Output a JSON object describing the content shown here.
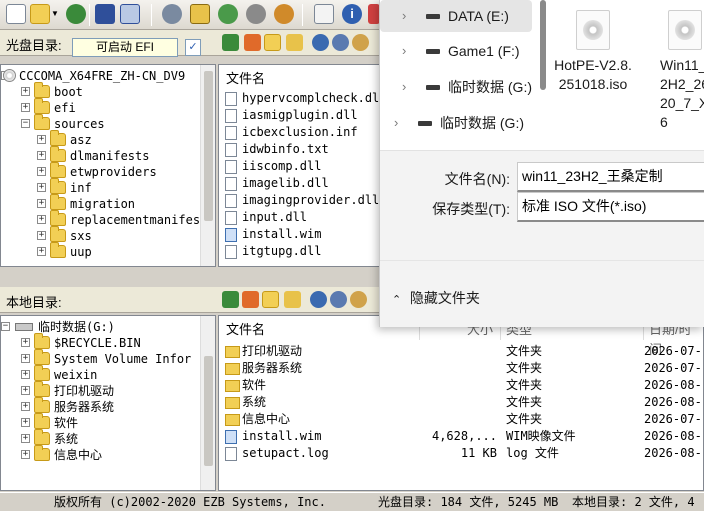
{
  "toolbar": {
    "icons": [
      "new-icon",
      "open-icon",
      "dropdown-arrow-icon",
      "extract-icon",
      "save-icon",
      "properties-icon",
      "burn-icon",
      "mount-icon",
      "compress-icon",
      "virtual-drive-icon",
      "bootable-icon",
      "help-icon",
      "info-icon",
      "exit-icon"
    ]
  },
  "cd_panel": {
    "label": "光盘目录:",
    "image_type": "可启动 EFI",
    "tree": [
      {
        "name": "CCCOMA_X64FRE_ZH-CN_DV9",
        "level": 0,
        "type": "disc"
      },
      {
        "name": "boot",
        "level": 1
      },
      {
        "name": "efi",
        "level": 1
      },
      {
        "name": "sources",
        "level": 1,
        "open": true
      },
      {
        "name": "asz",
        "level": 2
      },
      {
        "name": "dlmanifests",
        "level": 2
      },
      {
        "name": "etwproviders",
        "level": 2
      },
      {
        "name": "inf",
        "level": 2
      },
      {
        "name": "migration",
        "level": 2
      },
      {
        "name": "replacementmanifest",
        "level": 2
      },
      {
        "name": "sxs",
        "level": 2
      },
      {
        "name": "uup",
        "level": 2
      }
    ],
    "file_header": "文件名",
    "files": [
      {
        "name": "hypervcomplcheck.dll"
      },
      {
        "name": "iasmigplugin.dll"
      },
      {
        "name": "icbexclusion.inf"
      },
      {
        "name": "idwbinfo.txt"
      },
      {
        "name": "iiscomp.dll"
      },
      {
        "name": "imagelib.dll"
      },
      {
        "name": "imagingprovider.dll"
      },
      {
        "name": "input.dll"
      },
      {
        "name": "install.wim",
        "type": "wim"
      },
      {
        "name": "itgtupg.dll"
      }
    ]
  },
  "local_panel": {
    "label": "本地目录:",
    "tree": [
      {
        "name": "临时数据(G:)",
        "level": 0,
        "type": "drive"
      },
      {
        "name": "$RECYCLE.BIN",
        "level": 1
      },
      {
        "name": "System Volume Infor",
        "level": 1
      },
      {
        "name": "weixin",
        "level": 1
      },
      {
        "name": "打印机驱动",
        "level": 1
      },
      {
        "name": "服务器系统",
        "level": 1
      },
      {
        "name": "软件",
        "level": 1
      },
      {
        "name": "系统",
        "level": 1
      },
      {
        "name": "信息中心",
        "level": 1
      }
    ],
    "columns": {
      "name": "文件名",
      "size": "大小",
      "type": "类型",
      "date": "日期/时间"
    },
    "files": [
      {
        "name": "打印机驱动",
        "size": "",
        "type": "文件夹",
        "date": "2026-07-"
      },
      {
        "name": "服务器系统",
        "size": "",
        "type": "文件夹",
        "date": "2026-07-"
      },
      {
        "name": "软件",
        "size": "",
        "type": "文件夹",
        "date": "2026-08-"
      },
      {
        "name": "系统",
        "size": "",
        "type": "文件夹",
        "date": "2026-08-"
      },
      {
        "name": "信息中心",
        "size": "",
        "type": "文件夹",
        "date": "2026-07-"
      },
      {
        "name": "install.wim",
        "size": "4,628,...",
        "type": "WIM映像文件",
        "date": "2026-08-"
      },
      {
        "name": "setupact.log",
        "size": "11 KB",
        "type": "log 文件",
        "date": "2026-08-"
      }
    ]
  },
  "statusbar": {
    "copyright": "版权所有 (c)2002-2020 EZB Systems, Inc.",
    "cd_info": "光盘目录: 184 文件, 5245 MB",
    "local_info": "本地目录: 2 文件, 4"
  },
  "save_dialog": {
    "drives": [
      {
        "name": "DATA (E:)",
        "selected": true
      },
      {
        "name": "Game1 (F:)"
      },
      {
        "name": "临时数据 (G:)"
      },
      {
        "name": "临时数据 (G:)"
      }
    ],
    "iso_files": [
      {
        "name": "HotPE-V2.8.251018.iso"
      },
      {
        "name": "Win11_2H2_2620_7_X6"
      }
    ],
    "filename_label": "文件名(N):",
    "filename_value": "win11_23H2_王桑定制",
    "filetype_label": "保存类型(T):",
    "filetype_value": "标准 ISO 文件(*.iso)",
    "hide_folders": "隐藏文件夹"
  }
}
